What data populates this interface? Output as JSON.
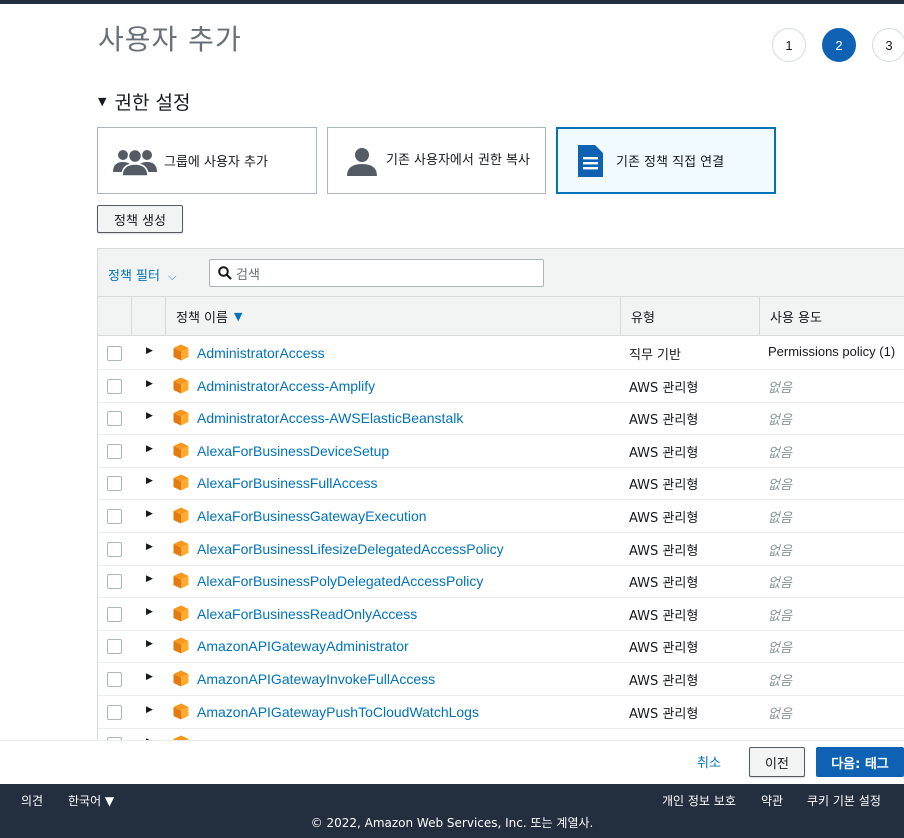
{
  "header": {
    "title": "사용자 추가"
  },
  "steps": [
    "1",
    "2",
    "3"
  ],
  "section": {
    "title": "권한 설정"
  },
  "options": [
    {
      "label": "그룹에 사용자 추가"
    },
    {
      "label": "기존 사용자에서 권한 복사"
    },
    {
      "label": "기존 정책 직접 연결"
    }
  ],
  "create_policy_label": "정책 생성",
  "filter": {
    "label": "정책 필터",
    "placeholder": "검색"
  },
  "columns": {
    "name": "정책 이름",
    "type": "유형",
    "usage": "사용 용도"
  },
  "policies": [
    {
      "name": "AdministratorAccess",
      "type": "직무 기반",
      "usage": "Permissions policy (1)"
    },
    {
      "name": "AdministratorAccess-Amplify",
      "type": "AWS 관리형",
      "usage": "없음"
    },
    {
      "name": "AdministratorAccess-AWSElasticBeanstalk",
      "type": "AWS 관리형",
      "usage": "없음"
    },
    {
      "name": "AlexaForBusinessDeviceSetup",
      "type": "AWS 관리형",
      "usage": "없음"
    },
    {
      "name": "AlexaForBusinessFullAccess",
      "type": "AWS 관리형",
      "usage": "없음"
    },
    {
      "name": "AlexaForBusinessGatewayExecution",
      "type": "AWS 관리형",
      "usage": "없음"
    },
    {
      "name": "AlexaForBusinessLifesizeDelegatedAccessPolicy",
      "type": "AWS 관리형",
      "usage": "없음"
    },
    {
      "name": "AlexaForBusinessPolyDelegatedAccessPolicy",
      "type": "AWS 관리형",
      "usage": "없음"
    },
    {
      "name": "AlexaForBusinessReadOnlyAccess",
      "type": "AWS 관리형",
      "usage": "없음"
    },
    {
      "name": "AmazonAPIGatewayAdministrator",
      "type": "AWS 관리형",
      "usage": "없음"
    },
    {
      "name": "AmazonAPIGatewayInvokeFullAccess",
      "type": "AWS 관리형",
      "usage": "없음"
    },
    {
      "name": "AmazonAPIGatewayPushToCloudWatchLogs",
      "type": "AWS 관리형",
      "usage": "없음"
    }
  ],
  "actions": {
    "cancel": "취소",
    "previous": "이전",
    "next": "다음: 태그"
  },
  "footer": {
    "feedback": "의견",
    "language": "한국어 ▼",
    "privacy": "개인 정보 보호",
    "terms": "약관",
    "cookies": "쿠키 기본 설정",
    "copyright": "© 2022, Amazon Web Services, Inc. 또는 계열사."
  },
  "colors": {
    "accent": "#0073bb",
    "primary": "#0f62b3",
    "footer_bg": "#232f3e",
    "cube": "#f7981d"
  }
}
